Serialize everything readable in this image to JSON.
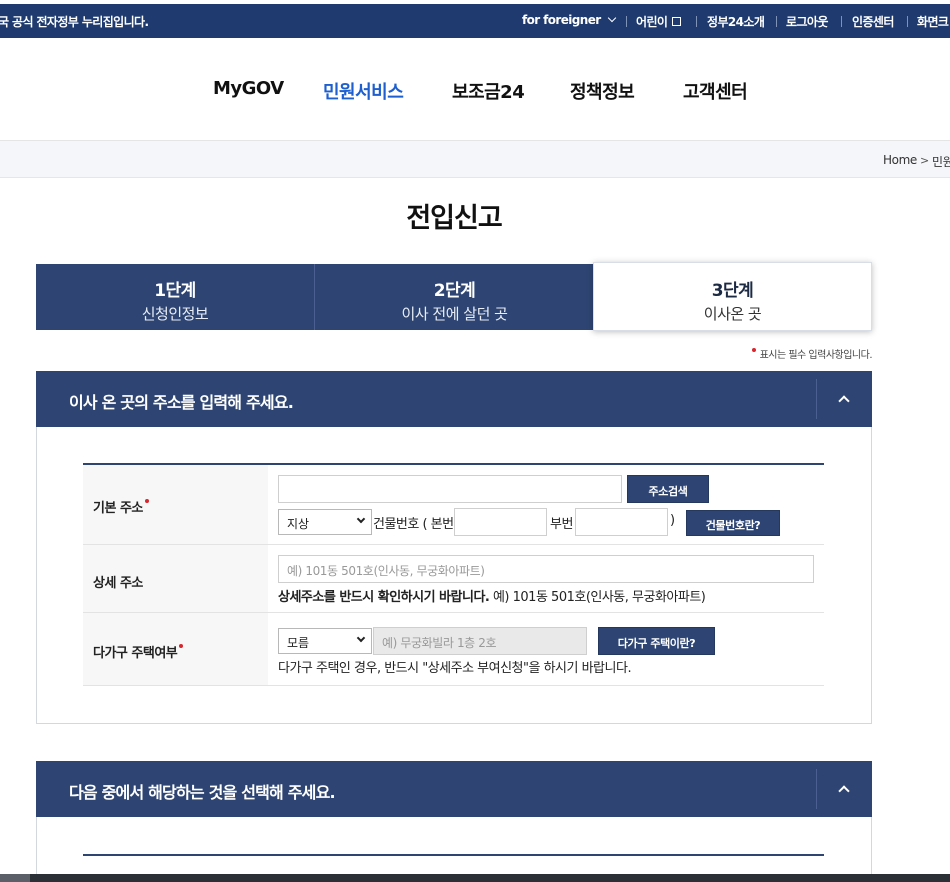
{
  "topbar": {
    "gov_text": "국 공식 전자정부 누리집입니다.",
    "links": [
      "for foreigner",
      "어린이",
      "정부24소개",
      "로그아웃",
      "인증센터",
      "화면크"
    ]
  },
  "nav": {
    "items": [
      "MyGOV",
      "민원서비스",
      "보조금24",
      "정책정보",
      "고객센터"
    ],
    "active": "민원서비스"
  },
  "breadcrumb": {
    "home": "Home",
    "next": "민원"
  },
  "page_title": "전입신고",
  "steps": [
    {
      "num": "1단계",
      "label": "신청인정보"
    },
    {
      "num": "2단계",
      "label": "이사 전에 살던 곳"
    },
    {
      "num": "3단계",
      "label": "이사온 곳"
    }
  ],
  "required_note": "표시는 필수 입력사항입니다.",
  "section1": {
    "title": "이사 온 곳의 주소를 입력해 주세요.",
    "basic_address": {
      "label": "기본 주소",
      "search_button": "주소검색",
      "ground_select": "지상",
      "building_no_label": "건물번호 ( 본번",
      "sub_no_label": "부번",
      "close_paren": ")",
      "building_help_button": "건물번호란?"
    },
    "detail_address": {
      "label": "상세 주소",
      "placeholder": "예) 101동 501호(인사동, 무궁화아파트)",
      "guide_bold": "상세주소를 반드시 확인하시기 바랍니다.",
      "guide_example": " 예) 101동 501호(인사동, 무궁화아파트)"
    },
    "multi_house": {
      "label": "다가구 주택여부",
      "select_value": "모름",
      "placeholder": "예) 무궁화빌라 1층 2호",
      "help_button": "다가구 주택이란?",
      "guide": "다가구 주택인 경우, 반드시 \"상세주소 부여신청\"을 하시기 바랍니다."
    }
  },
  "section2": {
    "title": "다음 중에서 해당하는 것을 선택해 주세요."
  },
  "colors": {
    "navy": "#2e4573",
    "topbar": "#1e3a6e",
    "active_menu": "#1e5fcf",
    "required": "#d8262c"
  }
}
